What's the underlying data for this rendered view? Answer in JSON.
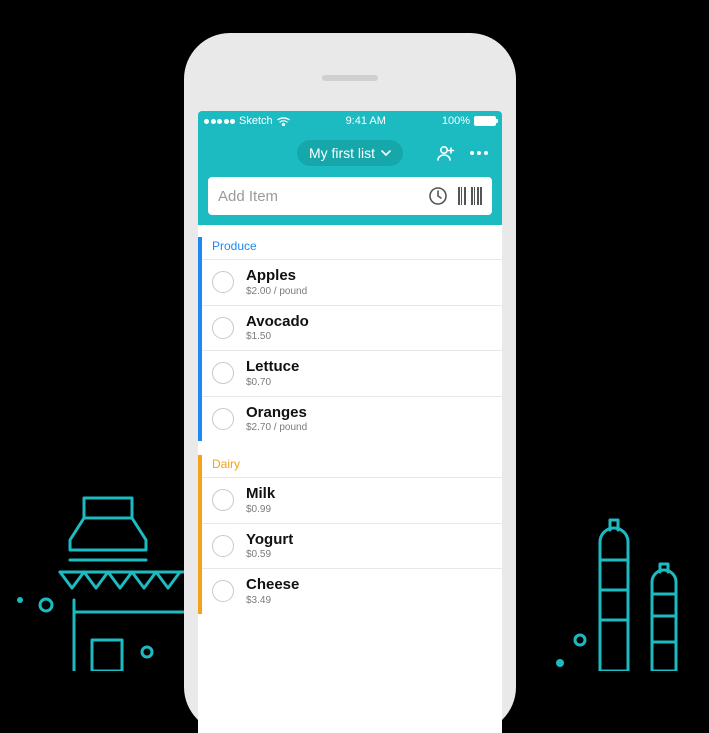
{
  "statusbar": {
    "carrier": "Sketch",
    "time": "9:41 AM",
    "battery_pct": "100%"
  },
  "header": {
    "list_title": "My first list"
  },
  "add_bar": {
    "placeholder": "Add Item"
  },
  "colors": {
    "teal": "#1cbbc2",
    "produce": "#1e88f2",
    "dairy": "#f4a11b"
  },
  "categories": [
    {
      "name": "Produce",
      "color_key": "produce",
      "items": [
        {
          "name": "Apples",
          "price": "$2.00 / pound"
        },
        {
          "name": "Avocado",
          "price": "$1.50"
        },
        {
          "name": "Lettuce",
          "price": "$0.70"
        },
        {
          "name": "Oranges",
          "price": "$2.70 / pound"
        }
      ]
    },
    {
      "name": "Dairy",
      "color_key": "dairy",
      "items": [
        {
          "name": "Milk",
          "price": "$0.99"
        },
        {
          "name": "Yogurt",
          "price": "$0.59"
        },
        {
          "name": "Cheese",
          "price": "$3.49"
        }
      ]
    }
  ]
}
